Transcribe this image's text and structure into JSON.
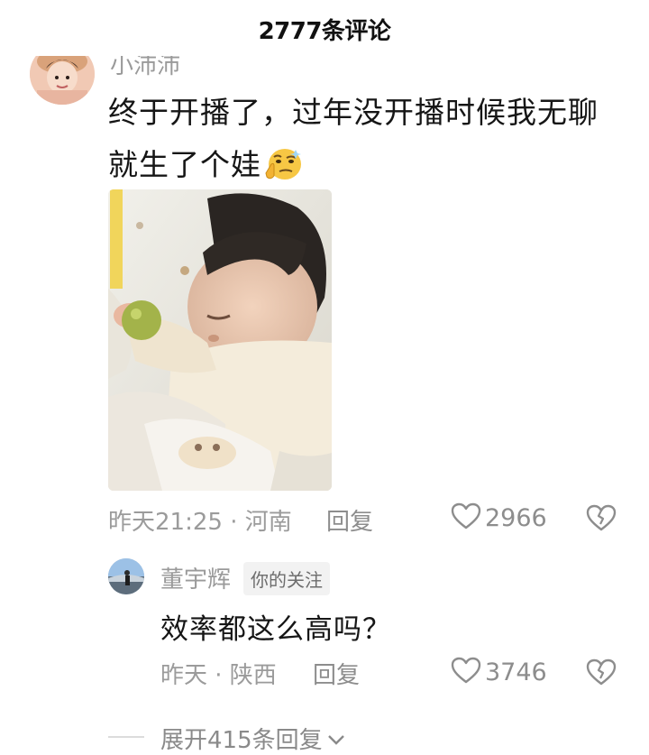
{
  "header": {
    "title": "2777条评论"
  },
  "main_comment": {
    "username": "小沛沛",
    "text": "终于开播了，过年没开播时候我无聊就生了个娃",
    "time_location": "昨天21:25 · 河南",
    "reply_label": "回复",
    "likes": "2966"
  },
  "reply_comment": {
    "username": "董宇辉",
    "badge": "你的关注",
    "text": "效率都这么高吗？",
    "time_location": "昨天 · 陕西",
    "reply_label": "回复",
    "likes": "3746"
  },
  "expand": {
    "label": "展开415条回复"
  },
  "colors": {
    "muted": "#9b9b9b",
    "text": "#161616",
    "badge_bg": "#f2f2f2"
  }
}
